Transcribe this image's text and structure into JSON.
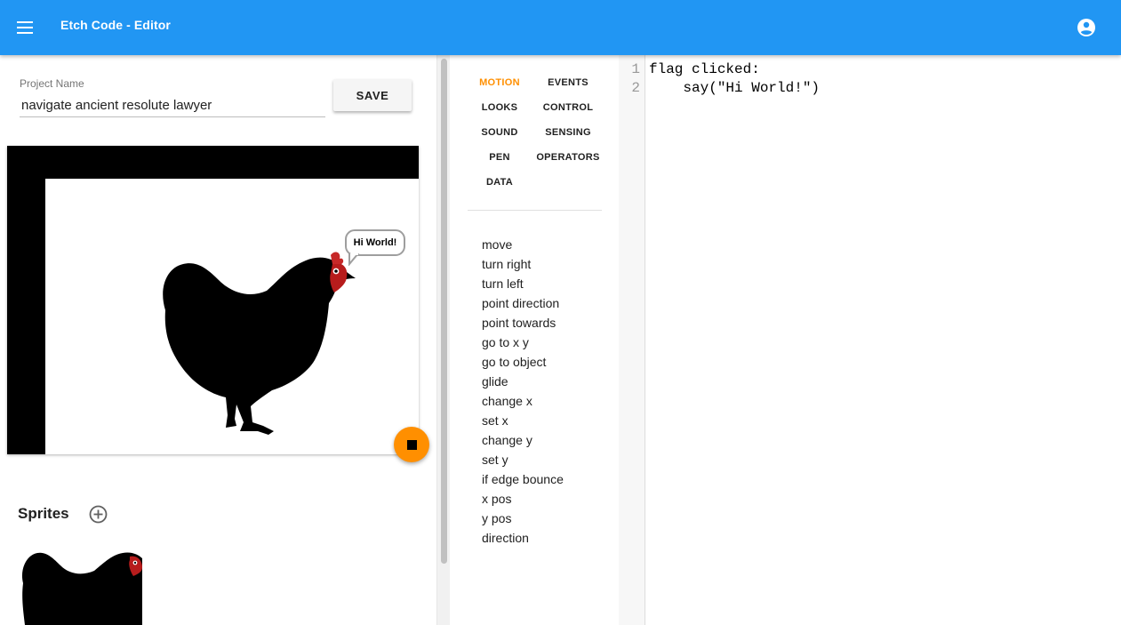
{
  "app_bar": {
    "title": "Etch Code - Editor",
    "menu_icon": "menu-icon",
    "account_icon": "account-circle-icon",
    "color": "#2196f3"
  },
  "project": {
    "name_label": "Project Name",
    "name_value": "navigate ancient resolute lawyer",
    "save_label": "SAVE"
  },
  "stage": {
    "speech_text": "Hi World!",
    "stop_icon": "stop-icon",
    "accent": "#ff8f00"
  },
  "sprites": {
    "title": "Sprites",
    "add_icon": "add-circle-icon"
  },
  "blocks": {
    "categories": [
      {
        "label": "MOTION",
        "active": true
      },
      {
        "label": "EVENTS"
      },
      {
        "label": "LOOKS"
      },
      {
        "label": "CONTROL"
      },
      {
        "label": "SOUND"
      },
      {
        "label": "SENSING"
      },
      {
        "label": "PEN"
      },
      {
        "label": "OPERATORS"
      },
      {
        "label": "DATA"
      }
    ],
    "items": [
      "move",
      "turn right",
      "turn left",
      "point direction",
      "point towards",
      "go to x y",
      "go to object",
      "glide",
      "change x",
      "set x",
      "change y",
      "set y",
      "if edge bounce",
      "x pos",
      "y pos",
      "direction"
    ]
  },
  "editor": {
    "line_numbers": [
      "1",
      "2"
    ],
    "lines": [
      "flag clicked:",
      "    say(\"Hi World!\")"
    ]
  }
}
